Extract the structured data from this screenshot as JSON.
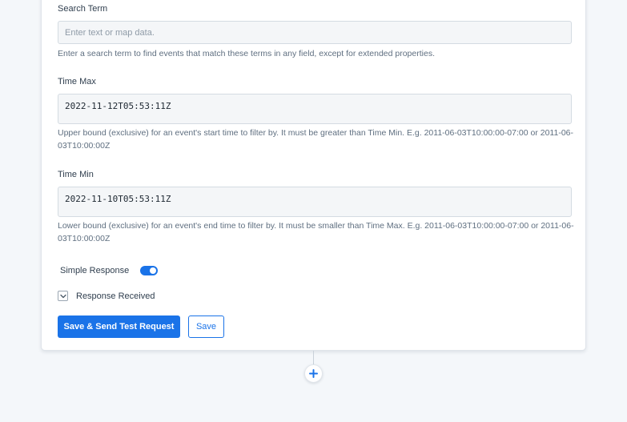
{
  "search_term": {
    "label": "Search Term",
    "placeholder": "Enter text or map data.",
    "help": "Enter a search term to find events that match these terms in any field, except for extended properties."
  },
  "time_max": {
    "label": "Time Max",
    "value": "2022-11-12T05:53:11Z",
    "help": "Upper bound (exclusive) for an event's start time to filter by. It must be greater than Time Min. E.g. 2011-06-03T10:00:00-07:00 or 2011-06-03T10:00:00Z"
  },
  "time_min": {
    "label": "Time Min",
    "value": "2022-11-10T05:53:11Z",
    "help": "Lower bound (exclusive) for an event's end time to filter by. It must be smaller than Time Max. E.g. 2011-06-03T10:00:00-07:00 or 2011-06-03T10:00:00Z"
  },
  "simple_response": {
    "label": "Simple Response",
    "enabled": true
  },
  "response_received": {
    "label": "Response Received",
    "icon": "chevron-down-icon"
  },
  "actions": {
    "save_send_label": "Save & Send Test Request",
    "save_label": "Save"
  },
  "add_step": {
    "icon": "plus-icon"
  },
  "colors": {
    "accent": "#1a73e8",
    "background": "#f4f7fa",
    "card": "#ffffff"
  }
}
